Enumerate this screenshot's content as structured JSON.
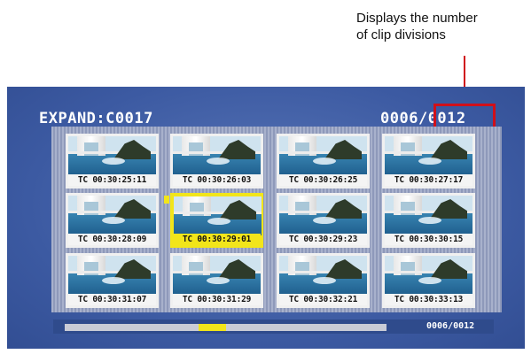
{
  "annotation": {
    "line1": "Displays the number",
    "line2": "of clip divisions",
    "leader_color": "#d0101a"
  },
  "screen": {
    "title": "EXPAND:C0017",
    "counter_current": "0006/",
    "counter_total": "0012"
  },
  "thumbnails": [
    {
      "tc": "TC 00:30:25:11",
      "selected": false
    },
    {
      "tc": "TC 00:30:26:03",
      "selected": false
    },
    {
      "tc": "TC 00:30:26:25",
      "selected": false
    },
    {
      "tc": "TC 00:30:27:17",
      "selected": false
    },
    {
      "tc": "TC 00:30:28:09",
      "selected": false
    },
    {
      "tc": "TC 00:30:29:01",
      "selected": true
    },
    {
      "tc": "TC 00:30:29:23",
      "selected": false
    },
    {
      "tc": "TC 00:30:30:15",
      "selected": false
    },
    {
      "tc": "TC 00:30:31:07",
      "selected": false
    },
    {
      "tc": "TC 00:30:31:29",
      "selected": false
    },
    {
      "tc": "TC 00:30:32:21",
      "selected": false
    },
    {
      "tc": "TC 00:30:33:13",
      "selected": false
    }
  ],
  "scroll": {
    "page_indicator": "0006/0012",
    "position_fraction": 0.455
  },
  "colors": {
    "screen_bg": "#3f5fa6",
    "selection": "#f2e51a",
    "highlight_box": "#d0101a"
  }
}
